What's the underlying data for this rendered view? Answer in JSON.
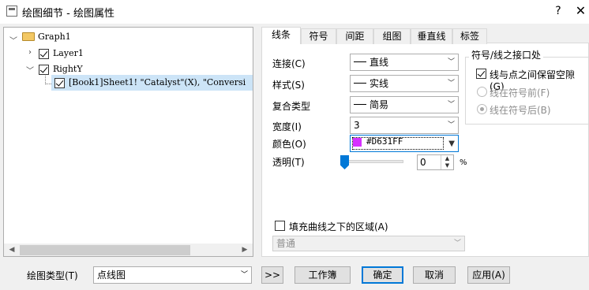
{
  "window": {
    "title": "绘图细节 - 绘图属性",
    "help_label": "?",
    "close_label": "✕"
  },
  "tree": {
    "root": "Graph1",
    "layer": "Layer1",
    "axis": "RightY",
    "plot": "[Book1]Sheet1! \"Catalyst\"(X), \"Conversi"
  },
  "tabs": [
    {
      "label": "线条",
      "active": true
    },
    {
      "label": "符号",
      "active": false
    },
    {
      "label": "间距",
      "active": false
    },
    {
      "label": "组图",
      "active": false
    },
    {
      "label": "垂直线",
      "active": false
    },
    {
      "label": "标签",
      "active": false
    }
  ],
  "line": {
    "connect": {
      "label": "连接(C)",
      "value": "直线"
    },
    "style": {
      "label": "样式(S)",
      "value": "实线"
    },
    "composite": {
      "label": "复合类型",
      "value": "简易"
    },
    "width": {
      "label": "宽度(I)",
      "value": "3"
    },
    "color": {
      "label": "颜色(O)",
      "value": "#D631FF",
      "swatch": "#D631FF"
    },
    "transparency": {
      "label": "透明(T)",
      "value": "0",
      "unit": "%",
      "level": 0
    }
  },
  "gap": {
    "title": "符号/线之接口处",
    "checkbox_label": "线与点之间保留空隙(G)",
    "checked": true,
    "radio_before": "线在符号前(F)",
    "radio_after": "线在符号后(B)",
    "selected": "after"
  },
  "fill": {
    "checkbox_label": "填充曲线之下的区域(A)",
    "checked": false,
    "mode": "普通"
  },
  "bottom": {
    "plot_type_label": "绘图类型(T)",
    "plot_type_value": "点线图",
    "more_label": ">>",
    "workbook_label": "工作簿",
    "ok_label": "确定",
    "cancel_label": "取消",
    "apply_label": "应用(A)"
  },
  "colors": {
    "accent": "#0078d7",
    "selection": "#cce4f7"
  }
}
